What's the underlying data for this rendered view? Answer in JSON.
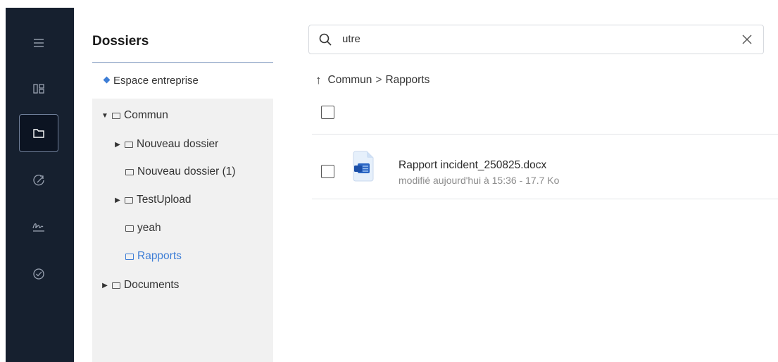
{
  "rail": {
    "items": [
      {
        "icon": "menu-icon"
      },
      {
        "icon": "dashboard-icon"
      },
      {
        "icon": "folder-icon",
        "active": true
      },
      {
        "icon": "share-icon"
      },
      {
        "icon": "signature-icon"
      },
      {
        "icon": "check-circle-icon"
      }
    ]
  },
  "folders": {
    "title": "Dossiers",
    "space_label": "Espace entreprise",
    "tree": [
      {
        "label": "Commun",
        "caret": "▼"
      },
      {
        "label": "Nouveau dossier",
        "caret": "▶"
      },
      {
        "label": "Nouveau dossier (1)",
        "caret": ""
      },
      {
        "label": "TestUpload",
        "caret": "▶"
      },
      {
        "label": "yeah",
        "caret": ""
      },
      {
        "label": "Rapports",
        "caret": ""
      },
      {
        "label": "Documents",
        "caret": "▶"
      }
    ]
  },
  "search": {
    "value": "utre"
  },
  "breadcrumb": {
    "up": "↑",
    "parent": "Commun",
    "separator": ">",
    "current": "Rapports"
  },
  "files": [
    {
      "name": "Rapport incident_250825.docx",
      "meta": "modifié aujourd'hui à 15:36  -  17.7 Ko",
      "type": "word-document-icon"
    }
  ],
  "colors": {
    "rail_bg": "#16202f",
    "accent": "#3e7ed6",
    "panel_bg": "#f1f1f1"
  }
}
